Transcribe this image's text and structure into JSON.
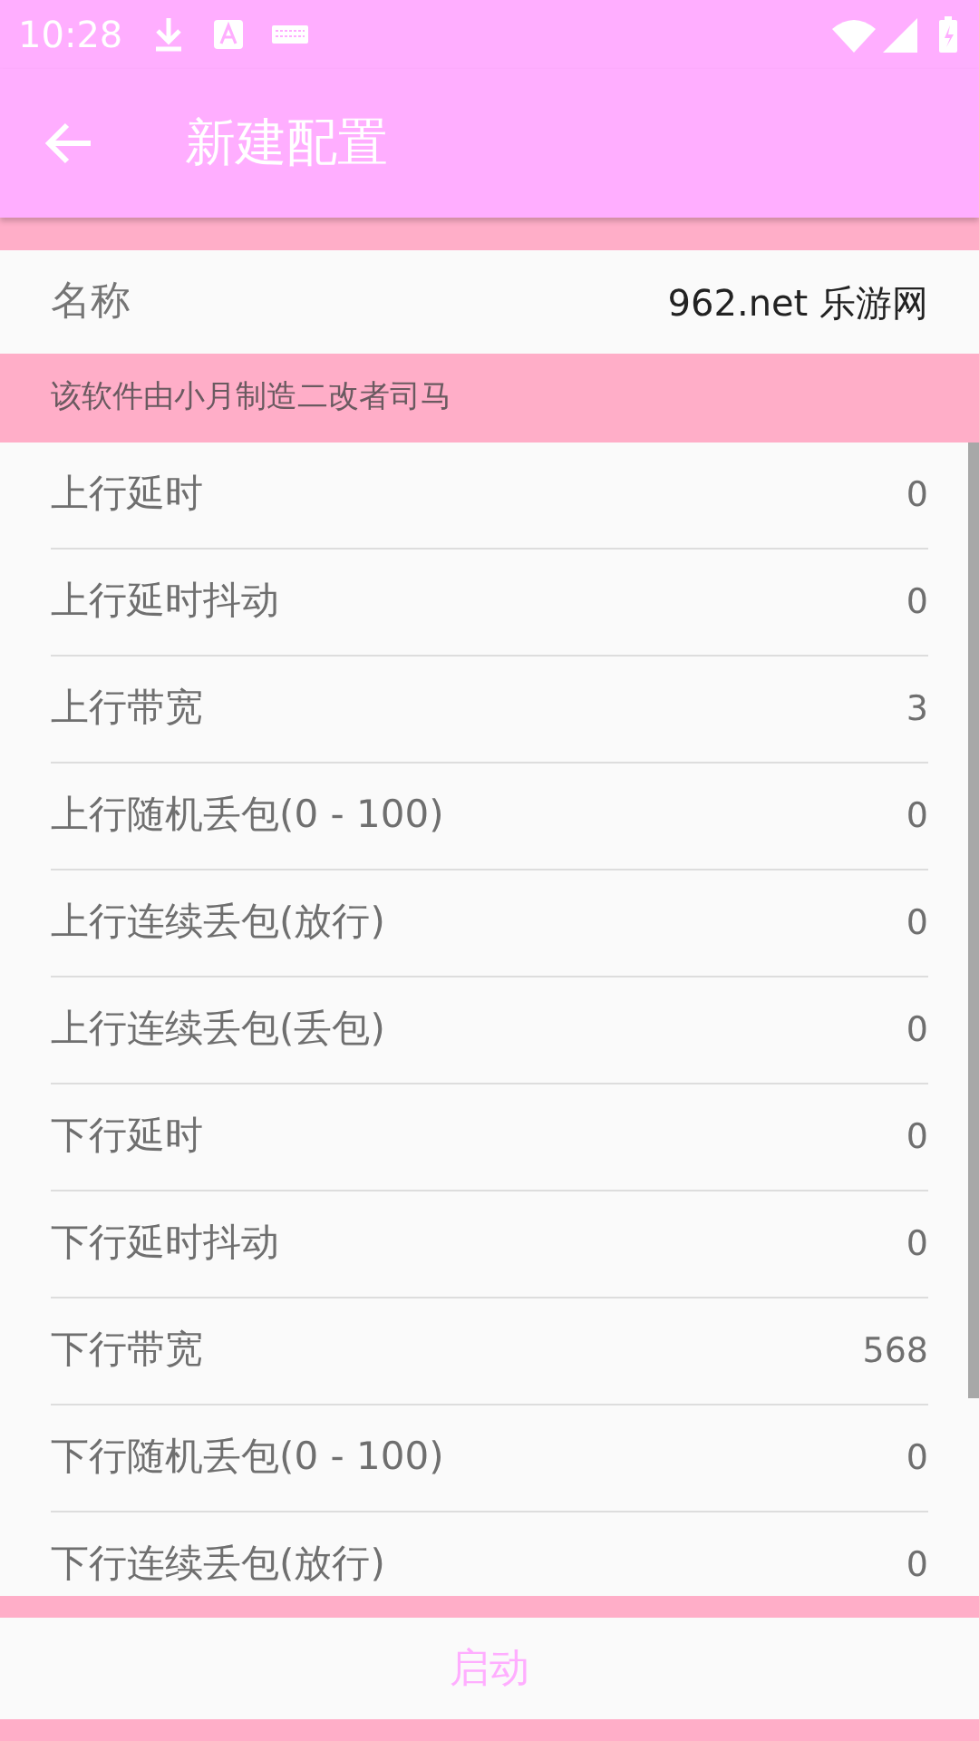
{
  "status_bar": {
    "time": "10:28"
  },
  "app_bar": {
    "title": "新建配置"
  },
  "name_row": {
    "label": "名称",
    "value": "962.net 乐游网"
  },
  "notice": "该软件由小月制造二改者司马",
  "settings": [
    {
      "label": "上行延时",
      "value": "0"
    },
    {
      "label": "上行延时抖动",
      "value": "0"
    },
    {
      "label": "上行带宽",
      "value": "3"
    },
    {
      "label": "上行随机丢包(0 - 100)",
      "value": "0"
    },
    {
      "label": "上行连续丢包(放行)",
      "value": "0"
    },
    {
      "label": "上行连续丢包(丢包)",
      "value": "0"
    },
    {
      "label": "下行延时",
      "value": "0"
    },
    {
      "label": "下行延时抖动",
      "value": "0"
    },
    {
      "label": "下行带宽",
      "value": "568"
    },
    {
      "label": "下行随机丢包(0 - 100)",
      "value": "0"
    },
    {
      "label": "下行连续丢包(放行)",
      "value": "0"
    }
  ],
  "start_button": "启动"
}
